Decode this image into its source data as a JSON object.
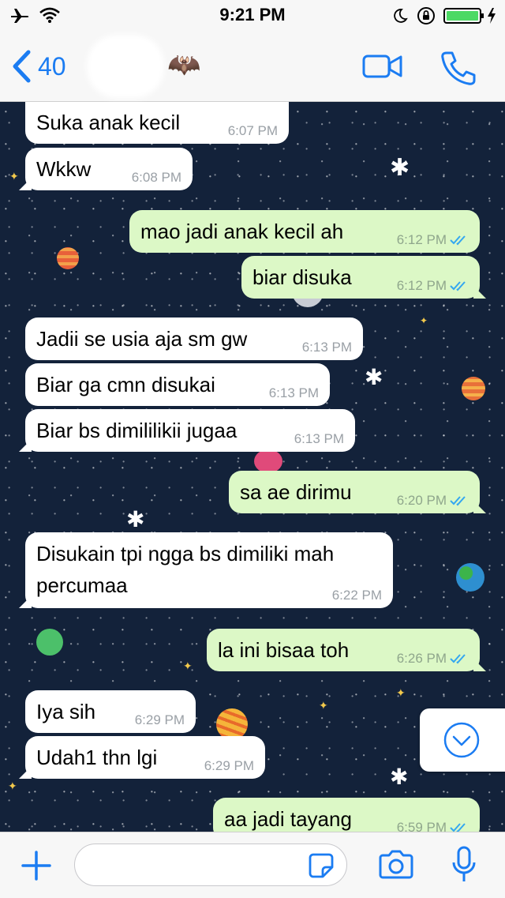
{
  "status": {
    "time": "9:21 PM",
    "battery_color": "#4cd964"
  },
  "header": {
    "back_count": "40",
    "contact_emoji": "🦇",
    "accent": "#1b7cf2"
  },
  "messages": [
    {
      "dir": "in",
      "text": "Suka anak kecil",
      "time": "6:07 PM"
    },
    {
      "dir": "in",
      "text": "Wkkw",
      "time": "6:08 PM"
    },
    {
      "dir": "out",
      "text": "mao jadi anak kecil ah",
      "time": "6:12 PM"
    },
    {
      "dir": "out",
      "text": "biar disuka",
      "time": "6:12 PM"
    },
    {
      "dir": "in",
      "text": "Jadii se usia aja sm gw",
      "time": "6:13 PM"
    },
    {
      "dir": "in",
      "text": "Biar ga cmn disukai",
      "time": "6:13 PM"
    },
    {
      "dir": "in",
      "text": "Biar bs dimililikii jugaa",
      "time": "6:13 PM"
    },
    {
      "dir": "out",
      "text": "sa ae dirimu",
      "time": "6:20 PM"
    },
    {
      "dir": "in",
      "text": "Disukain tpi ngga bs dimiliki mah\npercumaa",
      "time": "6:22 PM"
    },
    {
      "dir": "out",
      "text": "la ini bisaa toh",
      "time": "6:26 PM"
    },
    {
      "dir": "in",
      "text": "Iya sih",
      "time": "6:29 PM"
    },
    {
      "dir": "in",
      "text": "Udah1 thn lgi",
      "time": "6:29 PM"
    },
    {
      "dir": "out",
      "text": "aa jadi tayang",
      "time": "6:59 PM"
    }
  ],
  "composer": {
    "placeholder": ""
  },
  "icons": {
    "airplane": "airplane-icon",
    "wifi": "wifi-icon",
    "moon": "moon-icon",
    "lock": "rotation-lock-icon",
    "battery": "battery-icon",
    "back": "chevron-left-icon",
    "video": "video-call-icon",
    "phone": "phone-icon",
    "plus": "plus-icon",
    "sticker": "sticker-icon",
    "camera": "camera-icon",
    "mic": "microphone-icon",
    "read": "double-check-icon",
    "scroll": "chevron-down-circle-icon"
  }
}
